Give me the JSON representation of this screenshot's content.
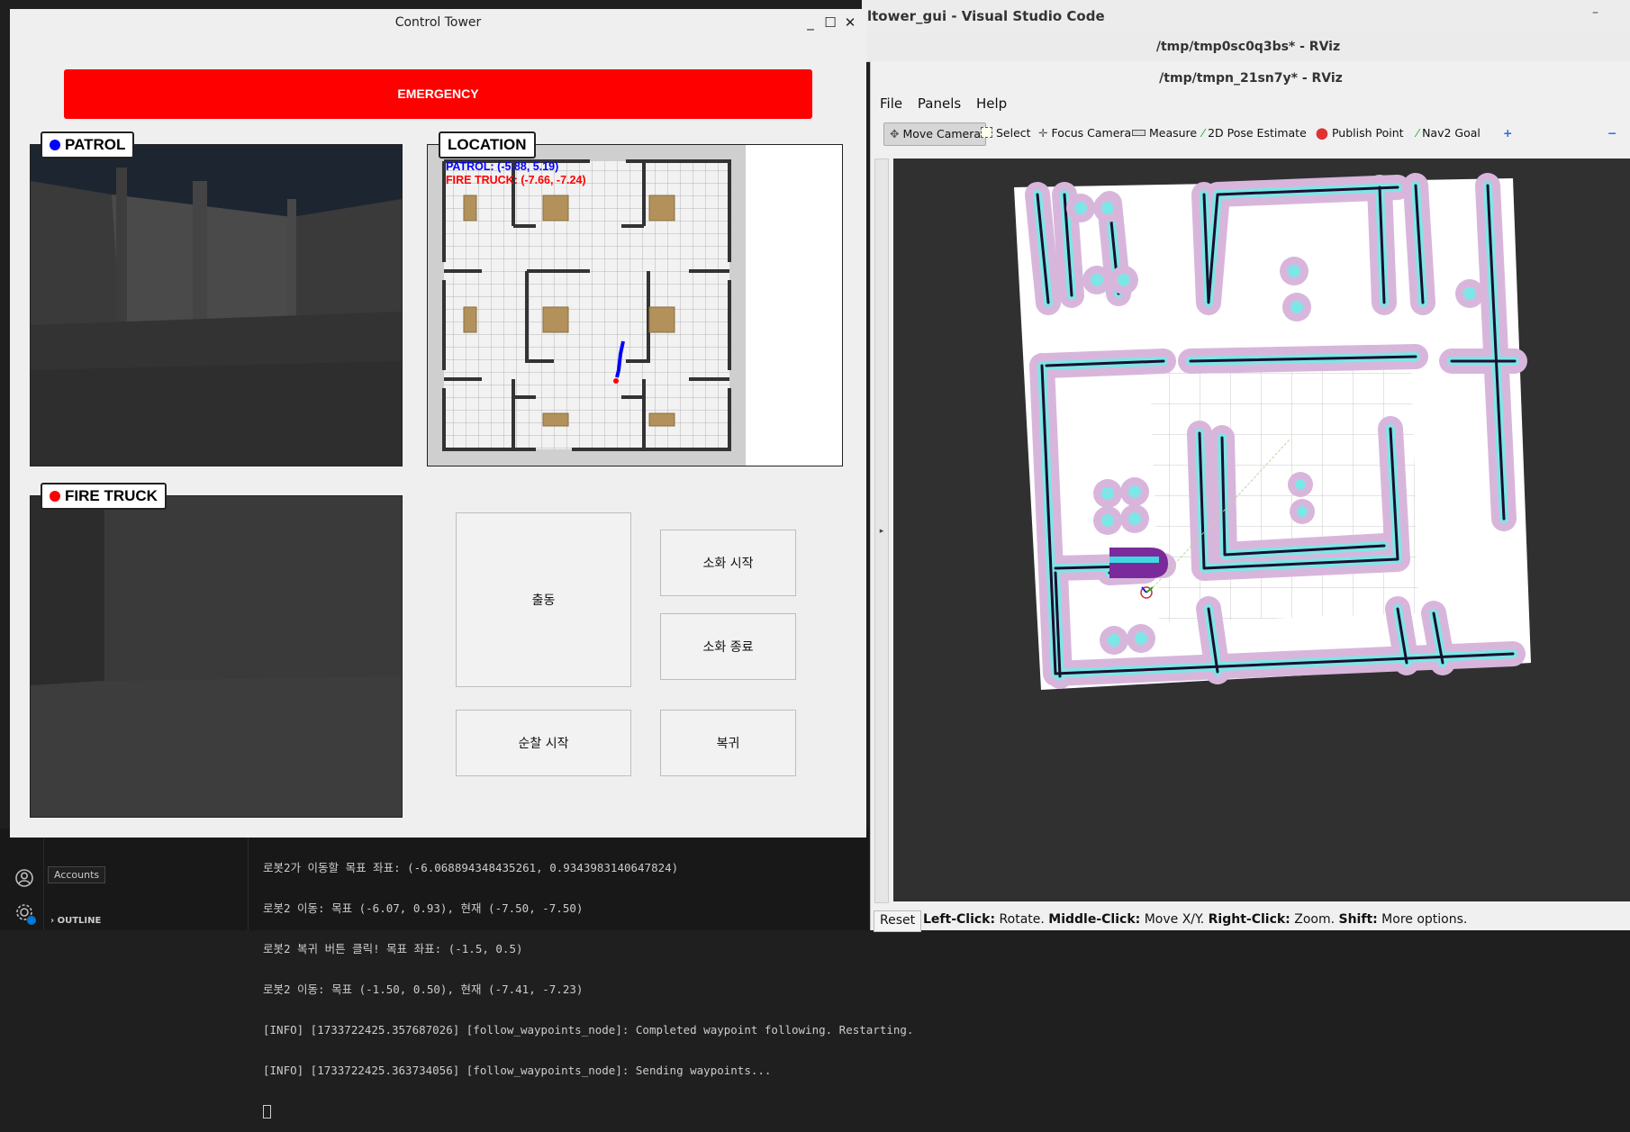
{
  "vscode": {
    "title_prefix": "ltower_gui - ",
    "title_app": "Visual Studio Code",
    "accounts_tooltip": "Accounts",
    "outline_label": "OUTLINE",
    "terminal_lines": [
      "로봇2가 이동할 목표 좌표: (-6.068894348435261, 0.9343983140647824)",
      "로봇2 이동: 목표 (-6.07, 0.93), 현재 (-7.50, -7.50)",
      "로봇2 복귀 버튼 클릭! 목표 좌표: (-1.5, 0.5)",
      "로봇2 이동: 목표 (-1.50, 0.50), 현재 (-7.41, -7.23)",
      "[INFO] [1733722425.357687026] [follow_waypoints_node]: Completed waypoint following. Restarting.",
      "[INFO] [1733722425.363734056] [follow_waypoints_node]: Sending waypoints..."
    ]
  },
  "control_tower": {
    "title": "Control Tower",
    "emergency_label": "EMERGENCY",
    "patrol_label": "PATROL",
    "location_label": "LOCATION",
    "fire_truck_label": "FIRE TRUCK",
    "patrol_coords": "PATROL: (-5.88, 5.19)",
    "fire_truck_coords": "FIRE TRUCK: (-7.66, -7.24)",
    "buttons": {
      "dispatch": "출동",
      "extinguish_start": "소화 시작",
      "extinguish_end": "소화 종료",
      "patrol_start": "순찰 시작",
      "return": "복귀"
    },
    "colors": {
      "emergency": "#ff0000",
      "patrol": "#0000ff",
      "fire_truck": "#ff0000"
    }
  },
  "rviz": {
    "back_window_title": "/tmp/tmp0sc0q3bs* - RViz",
    "title": "/tmp/tmpn_21sn7y* - RViz",
    "menu": [
      "File",
      "Panels",
      "Help"
    ],
    "tools": [
      "Move Camera",
      "Select",
      "Focus Camera",
      "Measure",
      "2D Pose Estimate",
      "Publish Point",
      "Nav2 Goal"
    ],
    "selected_tool": "Move Camera",
    "reset_label": "Reset",
    "status": [
      {
        "key": "Left-Click:",
        "val": " Rotate. "
      },
      {
        "key": "Middle-Click:",
        "val": " Move X/Y. "
      },
      {
        "key": "Right-Click:",
        "val": " Zoom. "
      },
      {
        "key": "Shift:",
        "val": " More options."
      }
    ]
  }
}
